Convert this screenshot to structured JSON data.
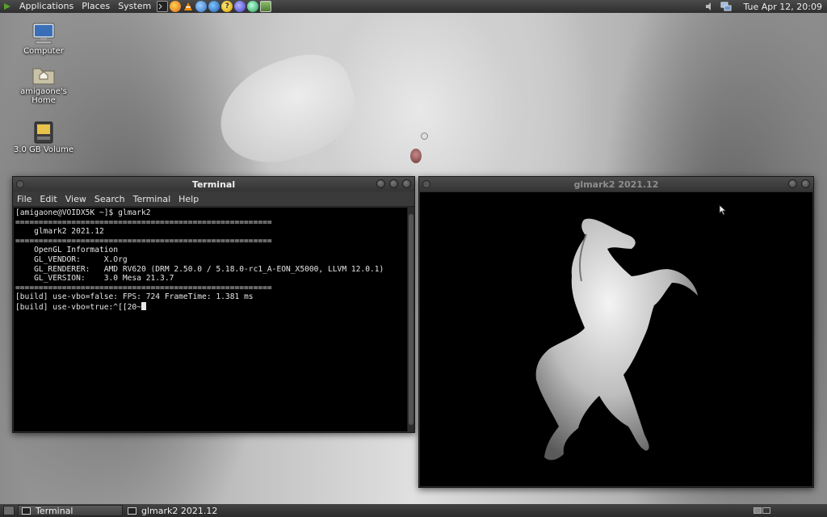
{
  "top_panel": {
    "menus": [
      "Applications",
      "Places",
      "System"
    ],
    "launchers": [
      "terminal-icon",
      "firefox-icon",
      "vlc-icon",
      "network-icon",
      "sound-icon",
      "help-icon",
      "browser-icon",
      "globe-icon",
      "image-viewer-icon"
    ],
    "clock": "Tue Apr 12, 20:09"
  },
  "desktop_icons": [
    {
      "label": "Computer",
      "icon": "computer-icon"
    },
    {
      "label": "amigaone's Home",
      "icon": "home-folder-icon"
    },
    {
      "label": "3.0 GB Volume",
      "icon": "drive-icon"
    }
  ],
  "terminal": {
    "title": "Terminal",
    "menu": [
      "File",
      "Edit",
      "View",
      "Search",
      "Terminal",
      "Help"
    ],
    "lines": [
      "[amigaone@VOIDX5K ~]$ glmark2",
      "=======================================================",
      "    glmark2 2021.12",
      "=======================================================",
      "    OpenGL Information",
      "    GL_VENDOR:     X.Org",
      "    GL_RENDERER:   AMD RV620 (DRM 2.50.0 / 5.18.0-rc1_A-EON_X5000, LLVM 12.0.1)",
      "    GL_VERSION:    3.0 Mesa 21.3.7",
      "=======================================================",
      "[build] use-vbo=false: FPS: 724 FrameTime: 1.381 ms",
      "[build] use-vbo=true:^[[20~"
    ]
  },
  "glmark_window": {
    "title": "glmark2 2021.12"
  },
  "taskbar": {
    "tasks": [
      "Terminal",
      "glmark2 2021.12"
    ]
  }
}
